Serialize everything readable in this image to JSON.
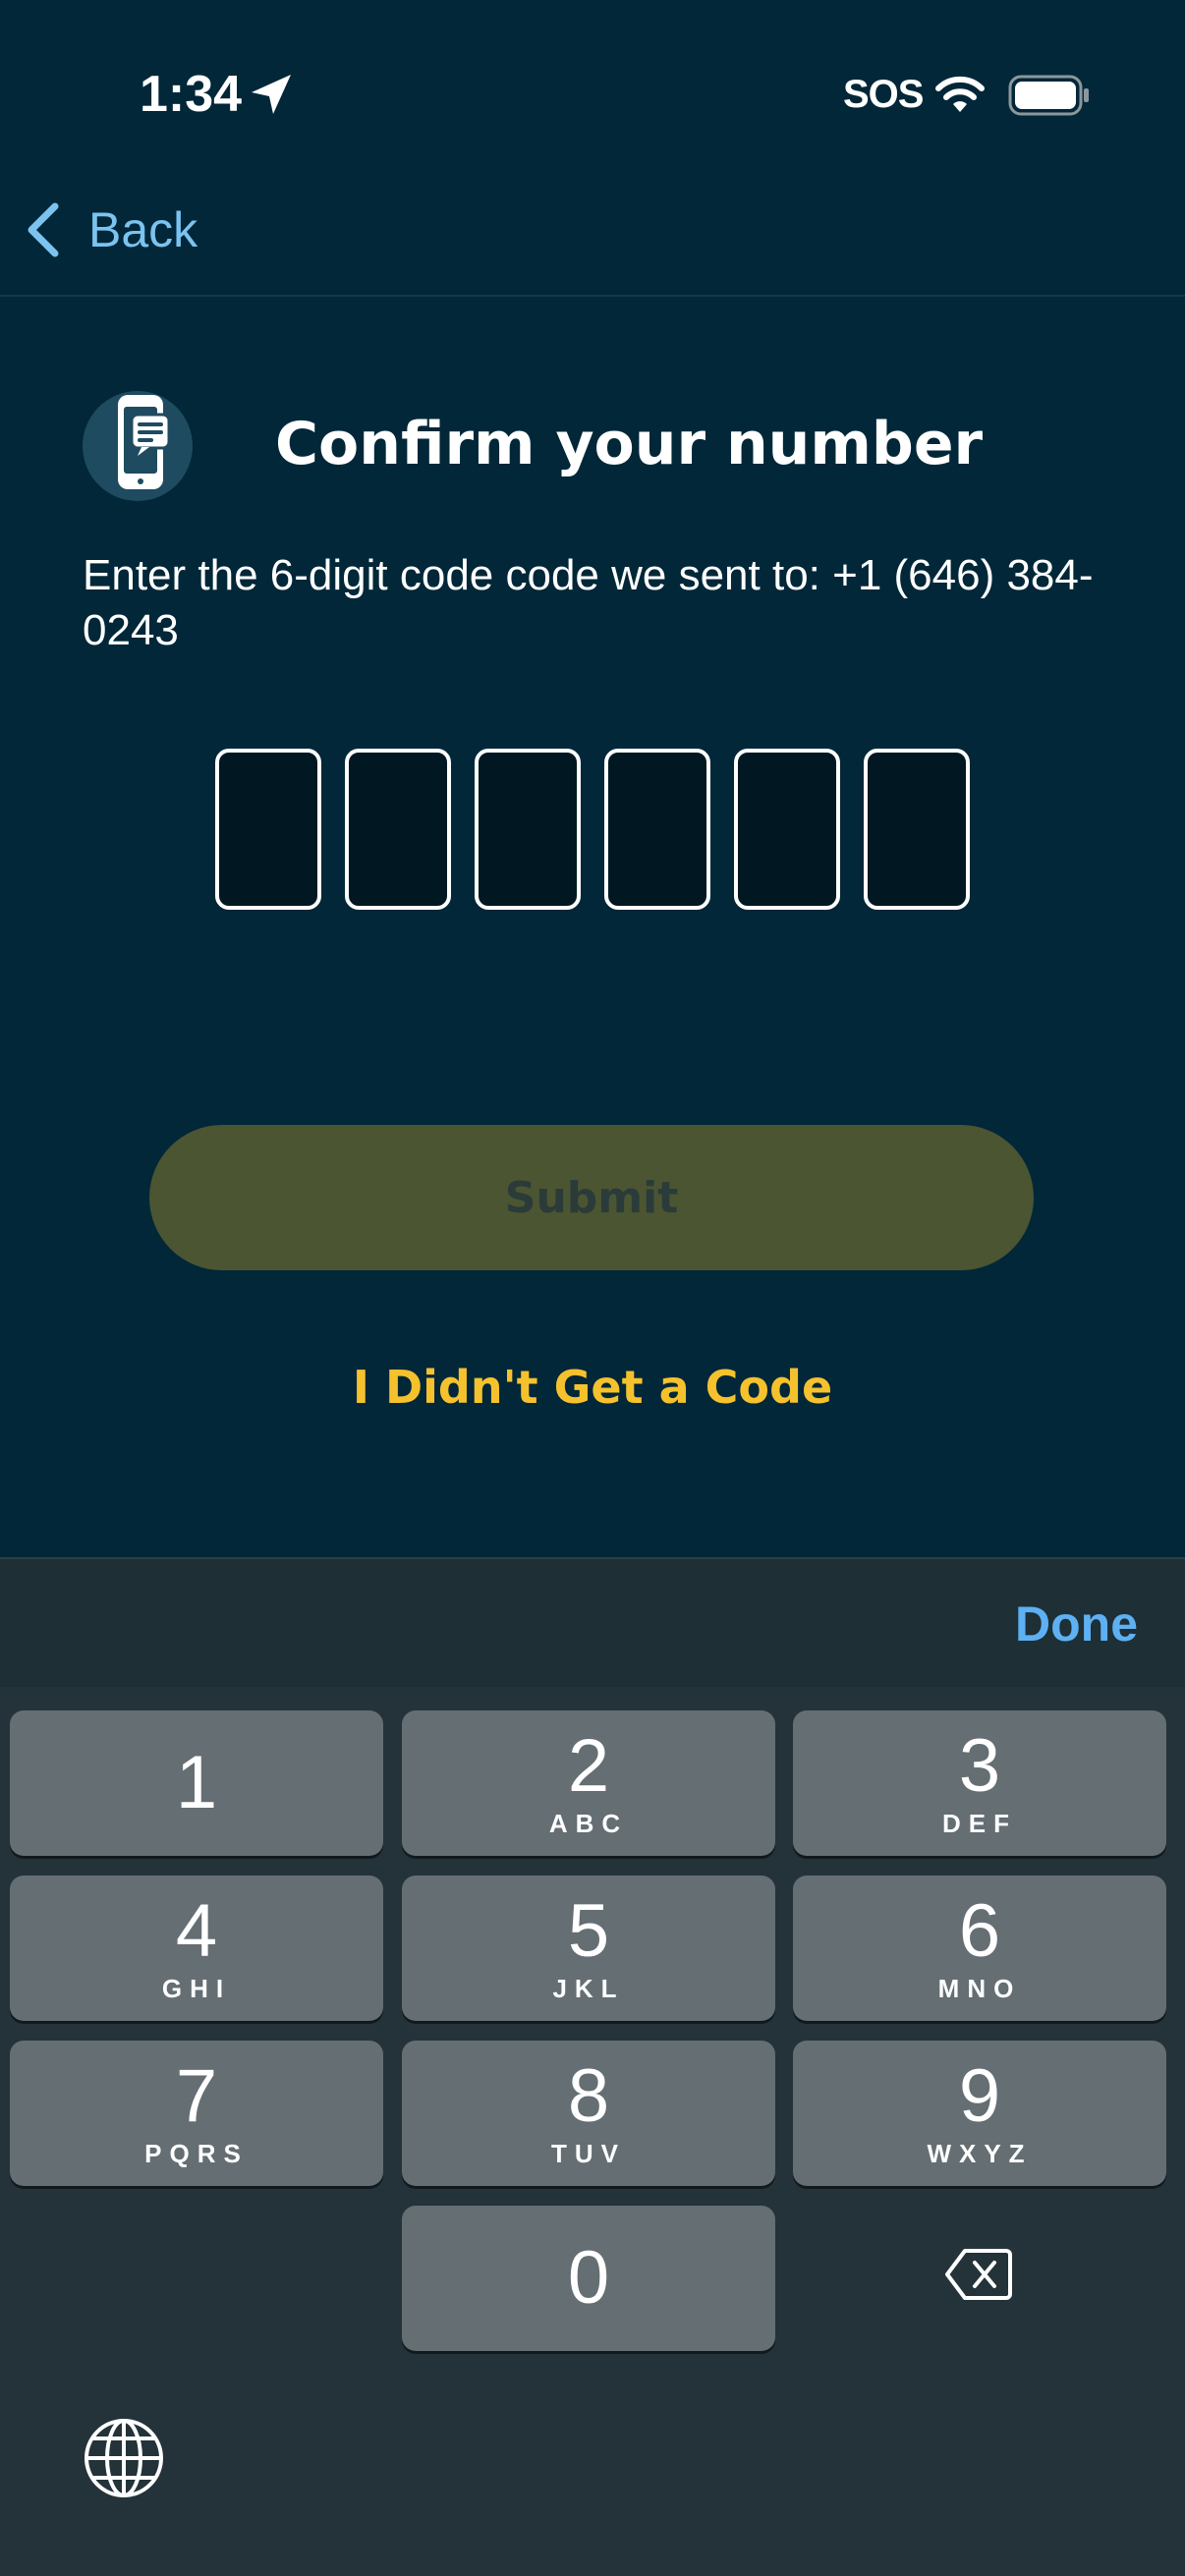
{
  "status_bar": {
    "time": "1:34",
    "carrier": "SOS",
    "icons": [
      "location-arrow-icon",
      "wifi-icon",
      "battery-icon"
    ]
  },
  "nav": {
    "back_label": "Back"
  },
  "header": {
    "icon": "phone-message-icon",
    "title": "Confirm your number"
  },
  "instruction": "Enter the 6-digit code code we sent to: +1 (646) 384-0243",
  "otp": {
    "length": 6,
    "values": [
      "",
      "",
      "",
      "",
      "",
      ""
    ]
  },
  "actions": {
    "submit_label": "Submit",
    "no_code_label": "I Didn't Get a Code"
  },
  "keyboard": {
    "done_label": "Done",
    "keys": [
      {
        "digit": "1",
        "letters": ""
      },
      {
        "digit": "2",
        "letters": "ABC"
      },
      {
        "digit": "3",
        "letters": "DEF"
      },
      {
        "digit": "4",
        "letters": "GHI"
      },
      {
        "digit": "5",
        "letters": "JKL"
      },
      {
        "digit": "6",
        "letters": "MNO"
      },
      {
        "digit": "7",
        "letters": "PQRS"
      },
      {
        "digit": "8",
        "letters": "TUV"
      },
      {
        "digit": "9",
        "letters": "WXYZ"
      },
      {
        "digit": "0",
        "letters": ""
      }
    ],
    "icons": [
      "backspace-icon",
      "globe-icon"
    ]
  },
  "colors": {
    "background": "#012738",
    "accent_link": "#7cc3ef",
    "secondary_link": "#f5c22d",
    "submit_disabled": "#4b5531",
    "keyboard_done": "#5db1f2"
  }
}
